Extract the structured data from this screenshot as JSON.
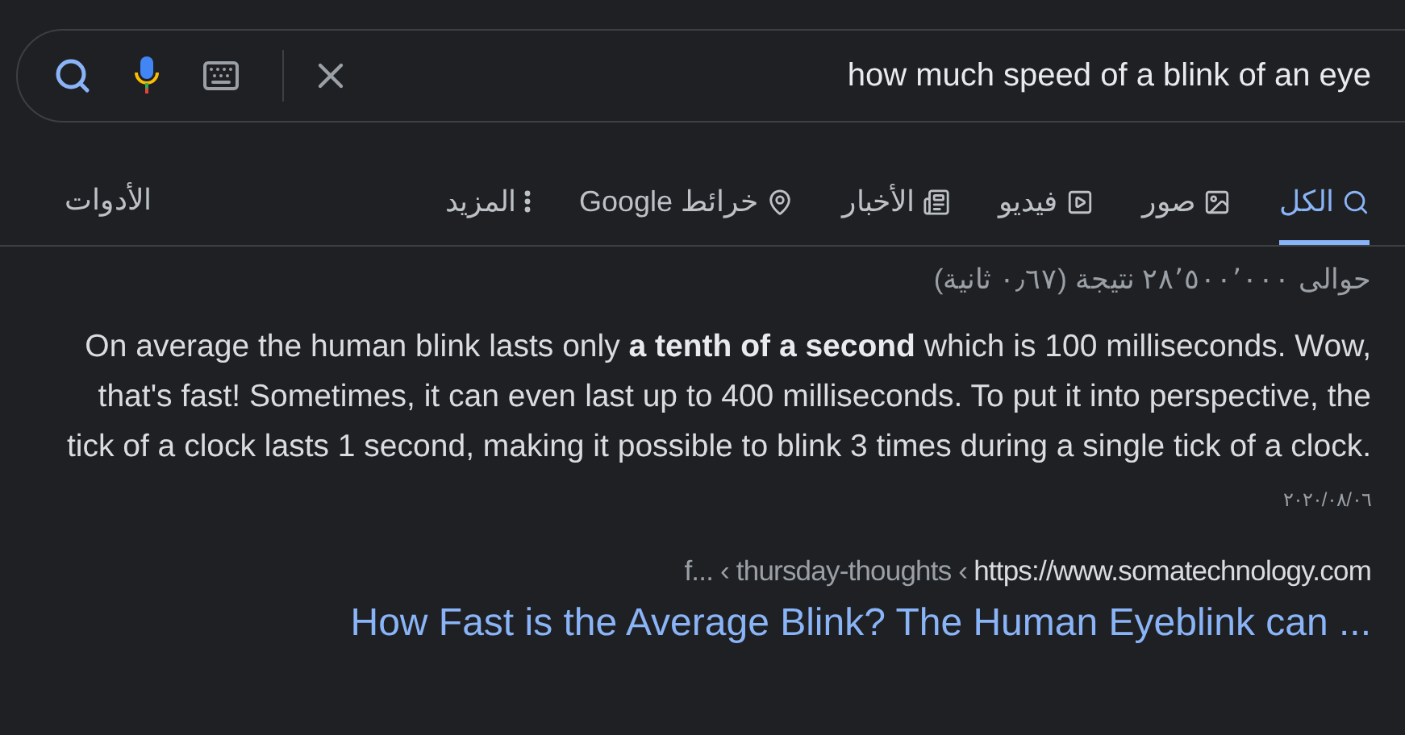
{
  "search": {
    "query": "how much speed of a blink of an eye"
  },
  "tabs": [
    {
      "label": "الكل",
      "kind": "search",
      "selected": true
    },
    {
      "label": "صور",
      "kind": "image",
      "selected": false
    },
    {
      "label": "فيديو",
      "kind": "video",
      "selected": false
    },
    {
      "label": "الأخبار",
      "kind": "news",
      "selected": false
    },
    {
      "label": "خرائط Google",
      "kind": "map",
      "selected": false
    },
    {
      "label": "المزيد",
      "kind": "more",
      "selected": false
    }
  ],
  "tools": "الأدوات",
  "stats": "حوالى ٢٨٬٥٠٠٬٠٠٠ نتيجة (٠٫٦٧ ثانية)",
  "result": {
    "snippet": "On average the human blink lasts only **a tenth of a second** which is 100 milliseconds. Wow, that's fast! Sometimes, it can even last up to 400 milliseconds. To put it into perspective, the tick of a clock lasts 1 second, making it possible to blink 3 times during a single tick of a clock.",
    "date": "٢٠٢٠/٠٨/٠٦",
    "breadcrumb": "f... ‹ thursday-thoughts ‹",
    "url": "https://www.somatechnology.com",
    "title": "How Fast is the Average Blink? The Human Eyeblink can ..."
  }
}
